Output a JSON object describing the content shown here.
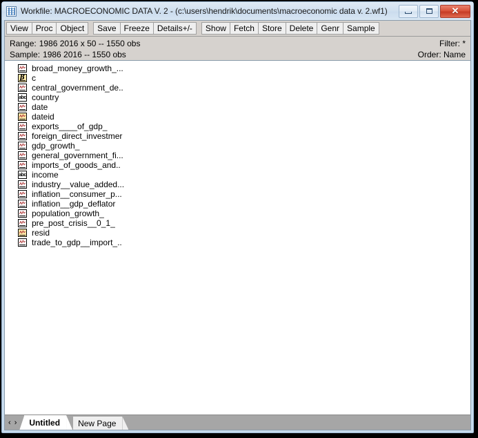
{
  "window": {
    "title": "Workfile: MACROECONOMIC DATA V. 2 - (c:\\users\\hendrik\\documents\\macroeconomic data v. 2.wf1)",
    "app_icon": "workfile-grid-icon",
    "controls": {
      "minimize": "minimize-button",
      "restore": "restore-button",
      "close_label": "✕"
    }
  },
  "toolbar": {
    "groups": [
      [
        "View",
        "Proc",
        "Object"
      ],
      [
        "Save",
        "Freeze",
        "Details+/-"
      ],
      [
        "Show",
        "Fetch",
        "Store",
        "Delete",
        "Genr",
        "Sample"
      ]
    ]
  },
  "info": {
    "range_label": "Range:",
    "range_value": "1986 2016 x 50  --  1550 obs",
    "filter_label": "Filter: *",
    "sample_label": "Sample:",
    "sample_value": "1986 2016  --  1550 obs",
    "order_label": "Order: Name"
  },
  "objects": [
    {
      "name": "broad_money_growth_...",
      "icon": "series-icon"
    },
    {
      "name": "c",
      "icon": "coefficient-icon"
    },
    {
      "name": "central_government_de..",
      "icon": "series-icon"
    },
    {
      "name": "country",
      "icon": "alpha-series-icon"
    },
    {
      "name": "date",
      "icon": "series-icon"
    },
    {
      "name": "dateid",
      "icon": "series-special-icon"
    },
    {
      "name": "exports____of_gdp_",
      "icon": "series-icon"
    },
    {
      "name": "foreign_direct_investmer",
      "icon": "series-icon"
    },
    {
      "name": "gdp_growth_",
      "icon": "series-icon"
    },
    {
      "name": "general_government_fi...",
      "icon": "series-icon"
    },
    {
      "name": "imports_of_goods_and..",
      "icon": "series-icon"
    },
    {
      "name": "income",
      "icon": "alpha-series-icon"
    },
    {
      "name": "industry__value_added...",
      "icon": "series-icon"
    },
    {
      "name": "inflation__consumer_p...",
      "icon": "series-icon"
    },
    {
      "name": "inflation__gdp_deflator",
      "icon": "series-icon"
    },
    {
      "name": "population_growth_",
      "icon": "series-icon"
    },
    {
      "name": "pre_post_crisis__0_1_",
      "icon": "series-icon"
    },
    {
      "name": "resid",
      "icon": "series-special-icon"
    },
    {
      "name": "trade_to_gdp__import_..",
      "icon": "series-icon"
    }
  ],
  "tabs": {
    "nav_label": "‹ ›",
    "pages": [
      {
        "label": "Untitled",
        "active": true
      },
      {
        "label": "New Page",
        "active": false
      }
    ]
  },
  "colors": {
    "window_border": "#c8dcee",
    "titlebar": "#d6e4f2",
    "toolbar_bg": "#d6d2ce",
    "list_bg": "#ffffff",
    "tabstrip_bg": "#a6a6a6",
    "close_red": "#d9543b",
    "icon_yellow": "#ffe9a8"
  }
}
